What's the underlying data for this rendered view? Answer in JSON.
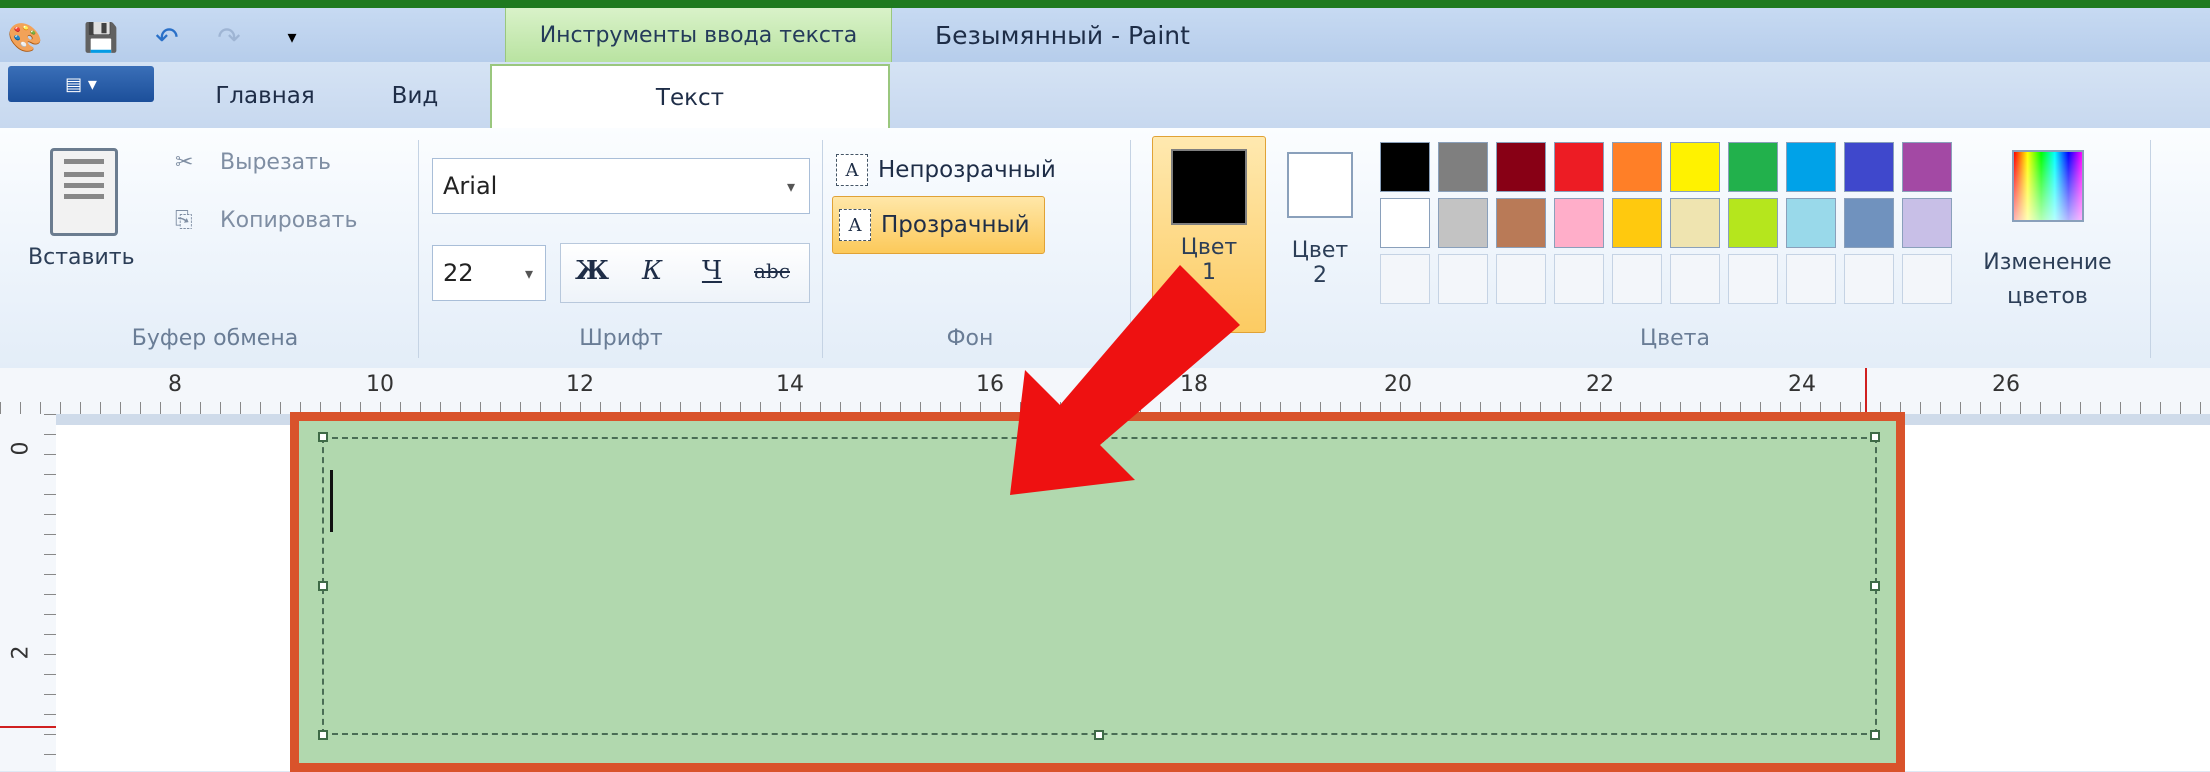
{
  "window": {
    "title": "Безымянный - Paint",
    "context_tab": "Инструменты ввода текста"
  },
  "tabs": {
    "home": "Главная",
    "view": "Вид",
    "text": "Текст"
  },
  "clipboard": {
    "paste": "Вставить",
    "cut": "Вырезать",
    "copy": "Копировать",
    "group": "Буфер обмена"
  },
  "font": {
    "name": "Arial",
    "size": "22",
    "bold": "Ж",
    "italic": "К",
    "underline": "Ч",
    "strike": "abc",
    "group": "Шрифт"
  },
  "background": {
    "opaque": "Непрозрачный",
    "transparent": "Прозрачный",
    "group": "Фон",
    "icon_letter": "A"
  },
  "colors": {
    "color1_label": "Цвет",
    "color1_num": "1",
    "color2_label": "Цвет",
    "color2_num": "2",
    "edit_label1": "Изменение",
    "edit_label2": "цветов",
    "group": "Цвета",
    "color1": "#000000",
    "color2": "#ffffff",
    "palette_row1": [
      "#000000",
      "#7f7f7f",
      "#880015",
      "#ed1c24",
      "#ff7f27",
      "#fff200",
      "#22b14c",
      "#00a2e8",
      "#3f48cc",
      "#a349a4"
    ],
    "palette_row2": [
      "#ffffff",
      "#c3c3c3",
      "#b97a57",
      "#ffaec9",
      "#ffc90e",
      "#efe4b0",
      "#b5e61d",
      "#99d9ea",
      "#7092be",
      "#c8bfe7"
    ]
  },
  "ruler": {
    "h_ticks": [
      "8",
      "10",
      "12",
      "14",
      "16",
      "18",
      "20",
      "22",
      "24",
      "26"
    ],
    "v_ticks": [
      "0",
      "2"
    ]
  },
  "annotation": {
    "arrow_color": "#ee1111",
    "highlight_color": "#d9532b",
    "textbox_fill": "#b1d8ae"
  }
}
